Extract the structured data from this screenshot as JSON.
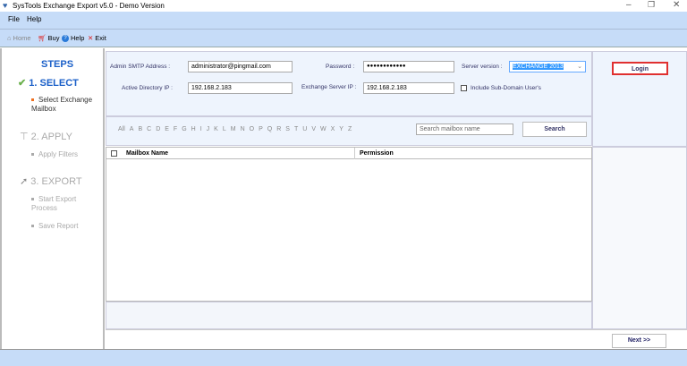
{
  "window": {
    "title": "SysTools Exchange Export v5.0 - Demo Version"
  },
  "menu": [
    "File",
    "Help"
  ],
  "toolbar": {
    "home": "Home",
    "buy": "Buy",
    "help": "Help",
    "exit": "Exit"
  },
  "sidebar": {
    "heading": "STEPS",
    "steps": [
      {
        "label": "1. SELECT",
        "subs": [
          "Select Exchange Mailbox"
        ]
      },
      {
        "label": "2. APPLY",
        "subs": [
          "Apply Filters"
        ]
      },
      {
        "label": "3. EXPORT",
        "subs": [
          "Start Export Process",
          "Save Report"
        ]
      }
    ]
  },
  "form": {
    "smtp_label": "Admin SMTP Address :",
    "smtp_value": "administrator@pingmail.com",
    "password_label": "Password :",
    "password_value": "●●●●●●●●●●●●",
    "server_version_label": "Server version :",
    "server_version_value": "EXCHANGE 2013",
    "ad_ip_label": "Active Directory IP :",
    "ad_ip_value": "192.168.2.183",
    "ex_ip_label": "Exchange Server IP :",
    "ex_ip_value": "192.168.2.183",
    "subdomain_label": "Include Sub-Domain User's",
    "subdomain_checked": false
  },
  "login_label": "Login",
  "alphabet": [
    "All",
    "A",
    "B",
    "C",
    "D",
    "E",
    "F",
    "G",
    "H",
    "I",
    "J",
    "K",
    "L",
    "M",
    "N",
    "O",
    "P",
    "Q",
    "R",
    "S",
    "T",
    "U",
    "V",
    "W",
    "X",
    "Y",
    "Z"
  ],
  "search": {
    "placeholder": "Search mailbox name",
    "button": "Search"
  },
  "table": {
    "columns": [
      "Mailbox Name",
      "Permission"
    ],
    "rows": []
  },
  "next_label": "Next >>",
  "colors": {
    "accent": "#c6dcf8",
    "login_border": "#e03030",
    "active_check": "#6ab04c",
    "step_active": "#1a5fc8"
  }
}
